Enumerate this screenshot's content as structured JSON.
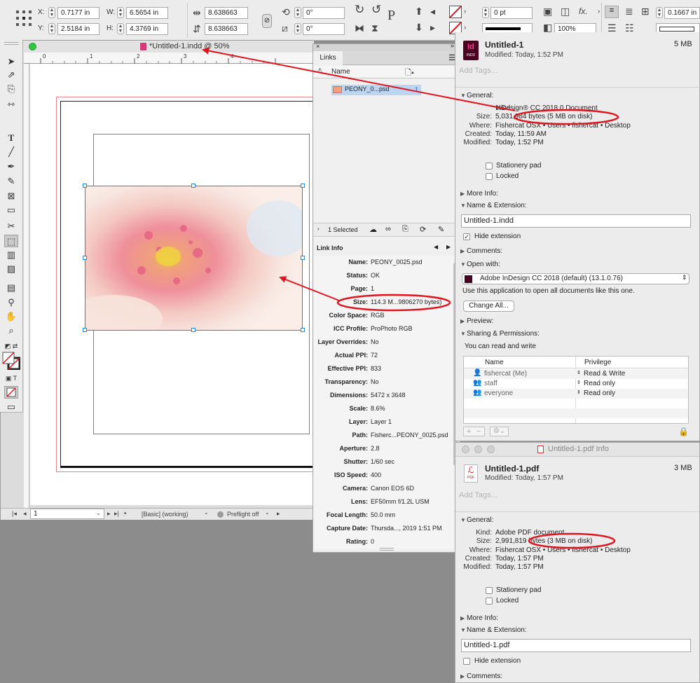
{
  "control_bar": {
    "x_label": "X:",
    "x_value": "0.7177 in",
    "y_label": "Y:",
    "y_value": "2.5184 in",
    "w_label": "W:",
    "w_value": "6.5654 in",
    "h_label": "H:",
    "h_value": "4.3769 in",
    "scale_x": "8.638663",
    "scale_y": "8.638663",
    "rotate": "0°",
    "shear": "0°",
    "stroke_weight": "0 pt",
    "opacity": "100%",
    "offset": "0.1667 in",
    "fx_label": "fx."
  },
  "document": {
    "title": "*Untitled-1.indd @ 50%",
    "ruler_marks": [
      "0",
      "1",
      "2",
      "3",
      "4"
    ],
    "page_field": "1",
    "status_profile": "[Basic] (working)",
    "preflight": "Preflight off"
  },
  "links_panel": {
    "tab": "Links",
    "col_name": "Name",
    "link_name": "PEONY_0...psd",
    "link_page": "1",
    "selected_count": "1 Selected",
    "link_info_label": "Link Info",
    "info": [
      {
        "k": "Name:",
        "v": "PEONY_0025.psd"
      },
      {
        "k": "Status:",
        "v": "OK"
      },
      {
        "k": "Page:",
        "v": "1"
      },
      {
        "k": "Size:",
        "v": "114.3 M...9806270 bytes)"
      },
      {
        "k": "Color Space:",
        "v": "RGB"
      },
      {
        "k": "ICC Profile:",
        "v": "ProPhoto RGB"
      },
      {
        "k": "Layer Overrides:",
        "v": "No"
      },
      {
        "k": "Actual PPI:",
        "v": "72"
      },
      {
        "k": "Effective PPI:",
        "v": "833"
      },
      {
        "k": "Transparency:",
        "v": "No"
      },
      {
        "k": "Dimensions:",
        "v": "5472 x 3648"
      },
      {
        "k": "Scale:",
        "v": "8.6%"
      },
      {
        "k": "Layer:",
        "v": "Layer 1"
      },
      {
        "k": "Path:",
        "v": "Fisherc...PEONY_0025.psd"
      },
      {
        "k": "Aperture:",
        "v": "2.8"
      },
      {
        "k": "Shutter:",
        "v": "1/60 sec"
      },
      {
        "k": "ISO Speed:",
        "v": "400"
      },
      {
        "k": "Camera:",
        "v": "Canon EOS 6D"
      },
      {
        "k": "Lens:",
        "v": "EF50mm f/1.2L USM"
      },
      {
        "k": "Focal Length:",
        "v": "50.0 mm"
      },
      {
        "k": "Capture Date:",
        "v": "Thursda..., 2019 1:51 PM"
      },
      {
        "k": "Rating:",
        "v": "0"
      }
    ]
  },
  "indd_info": {
    "filename": "Untitled-1",
    "size_short": "5 MB",
    "modified": "Modified: Today, 1:52 PM",
    "tags_placeholder": "Add Tags...",
    "general_label": "General:",
    "kind_k": "Kind:",
    "kind_v": "InDesign® CC 2018.0 Document",
    "size_k": "Size:",
    "size_v": "5,031,984 bytes (5 MB on disk)",
    "where_k": "Where:",
    "where_v": "Fishercat OSX • Users • fishercat • Desktop",
    "created_k": "Created:",
    "created_v": "Today, 11:59 AM",
    "modified_k": "Modified:",
    "modified_v": "Today, 1:52 PM",
    "stationery": "Stationery pad",
    "locked": "Locked",
    "more_info": "More Info:",
    "name_ext": "Name & Extension:",
    "name_value": "Untitled-1.indd",
    "hide_ext": "Hide extension",
    "comments": "Comments:",
    "open_with": "Open with:",
    "open_with_app": "Adobe InDesign CC 2018 (default) (13.1.0.76)",
    "use_app_text": "Use this application to open all documents like this one.",
    "change_all": "Change All...",
    "preview": "Preview:",
    "sharing": "Sharing & Permissions:",
    "read_write_text": "You can read and write",
    "col_name": "Name",
    "col_privilege": "Privilege",
    "perms": [
      {
        "name": "fishercat (Me)",
        "priv": "Read & Write"
      },
      {
        "name": "staff",
        "priv": "Read only"
      },
      {
        "name": "everyone",
        "priv": "Read only"
      }
    ]
  },
  "pdf_info": {
    "window_title": "Untitled-1.pdf Info",
    "filename": "Untitled-1.pdf",
    "size_short": "3 MB",
    "modified": "Modified: Today, 1:57 PM",
    "tags_placeholder": "Add Tags...",
    "general_label": "General:",
    "kind_k": "Kind:",
    "kind_v": "Adobe PDF document",
    "size_k": "Size:",
    "size_v": "2,991,819 bytes (3 MB on disk)",
    "where_k": "Where:",
    "where_v": "Fishercat OSX • Users • fishercat • Desktop",
    "created_k": "Created:",
    "created_v": "Today, 1:57 PM",
    "modified_k": "Modified:",
    "modified_v": "Today, 1:57 PM",
    "stationery": "Stationery pad",
    "locked": "Locked",
    "more_info": "More Info:",
    "name_ext": "Name & Extension:",
    "name_value": "Untitled-1.pdf",
    "hide_ext": "Hide extension",
    "comments": "Comments:"
  },
  "icons": {
    "indd": "Id",
    "indd_sub": "INDD",
    "pdf_sub": "PDF"
  },
  "colors": {
    "annotation_red": "#e0141e",
    "selection_blue": "#1e88e5",
    "margin_purple": "#b04fe0",
    "bleed_red": "#e8848c",
    "indesign_pink": "#49021f"
  }
}
